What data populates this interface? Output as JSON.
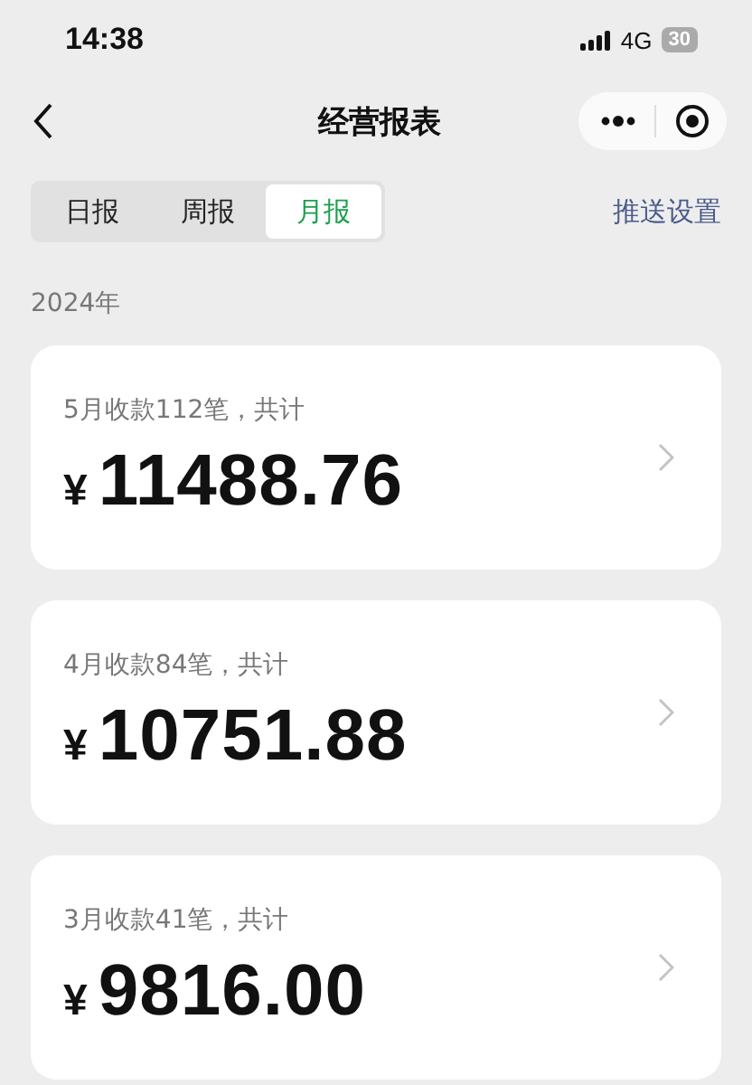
{
  "status_bar": {
    "time": "14:38",
    "network": "4G",
    "battery": "30"
  },
  "nav": {
    "title": "经营报表"
  },
  "tabs": [
    {
      "label": "日报",
      "selected": false
    },
    {
      "label": "周报",
      "selected": false
    },
    {
      "label": "月报",
      "selected": true
    }
  ],
  "push_settings": "推送设置",
  "year": "2024年",
  "cards": [
    {
      "caption": "5月收款112笔，共计",
      "currency": "¥",
      "amount": "11488.76"
    },
    {
      "caption": "4月收款84笔，共计",
      "currency": "¥",
      "amount": "10751.88"
    },
    {
      "caption": "3月收款41笔，共计",
      "currency": "¥",
      "amount": "9816.00"
    }
  ]
}
